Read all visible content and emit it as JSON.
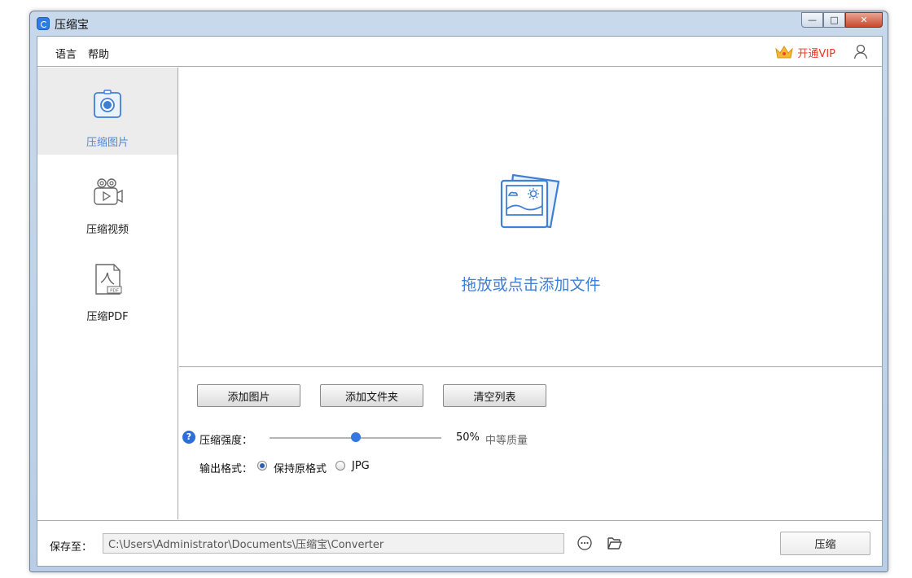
{
  "window": {
    "title": "压缩宝"
  },
  "menu": {
    "items": [
      {
        "label": "语言"
      },
      {
        "label": "帮助"
      }
    ]
  },
  "vip": {
    "label": "开通VIP",
    "color": "#e8382c"
  },
  "sidebar": {
    "items": [
      {
        "label": "压缩图片",
        "icon": "camera-icon",
        "active": true
      },
      {
        "label": "压缩视频",
        "icon": "video-camera-icon",
        "active": false
      },
      {
        "label": "压缩PDF",
        "icon": "pdf-file-icon",
        "active": false
      }
    ]
  },
  "dropzone": {
    "text": "拖放或点击添加文件",
    "icon": "image-gallery-icon"
  },
  "buttons": {
    "add_images": "添加图片",
    "add_folder": "添加文件夹",
    "clear_list": "清空列表"
  },
  "compression": {
    "label": "压缩强度：",
    "value_percent": 50,
    "value_text": "50%",
    "quality_text": "中等质量"
  },
  "output_format": {
    "label": "输出格式：",
    "options": [
      {
        "label": "保持原格式",
        "checked": true
      },
      {
        "label": "JPG",
        "checked": false
      }
    ]
  },
  "footer": {
    "save_label": "保存至：",
    "save_path": "C:\\Users\\Administrator\\Documents\\压缩宝\\Converter",
    "compress_label": "压缩"
  },
  "colors": {
    "accent": "#3f7fd6",
    "slider": "#3577e0"
  }
}
